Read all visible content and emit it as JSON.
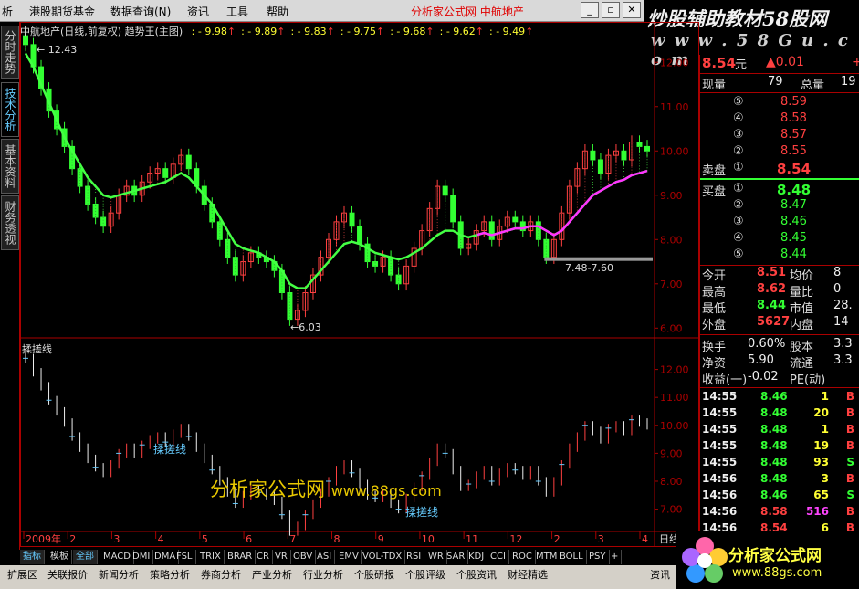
{
  "menu": {
    "items": [
      "析",
      "港股期货基金",
      "数据查询(N)",
      "资讯",
      "工具",
      "帮助"
    ],
    "title": "分析家公式网  中航地产"
  },
  "brand": {
    "title": "炒股辅助教材58股网",
    "url": "w w w . 5 8 G u . c o m"
  },
  "left_tabs": [
    "分时走势",
    "技术分析",
    "基本资料",
    "财务透视"
  ],
  "chart_title": "中航地产(日线,前复权) 趋势王(主图)",
  "ma_values": [
    "9.98",
    "9.89",
    "9.83",
    "9.75",
    "9.68",
    "9.62",
    "9.49"
  ],
  "ma_sep": ": - ",
  "annotations": {
    "high": "12.43",
    "low": "6.03",
    "range": "7.48-7.60",
    "sub_indicator": "揉搓线",
    "sub_label1": "揉搓线",
    "sub_label2": "揉搓线",
    "watermark1": "分析家公式网",
    "watermark2": "www.88gs.com"
  },
  "chart_data": {
    "type": "line",
    "main_ylim": [
      5.8,
      12.5
    ],
    "main_yticks": [
      "12.00",
      "11.00",
      "10.00",
      "9.00",
      "8.00",
      "7.00",
      "6.00"
    ],
    "sub_yticks": [
      "12.00",
      "11.00",
      "10.00",
      "9.00",
      "8.00",
      "7.00"
    ],
    "x_labels": [
      "2009年",
      "2",
      "3",
      "4",
      "5",
      "6",
      "7",
      "8",
      "9",
      "10",
      "11",
      "12",
      "2",
      "3",
      "4"
    ],
    "price": [
      12.4,
      11.9,
      11.4,
      10.9,
      10.5,
      10.1,
      9.6,
      9.2,
      8.8,
      8.5,
      8.3,
      8.6,
      9.0,
      9.2,
      9.0,
      9.3,
      9.5,
      9.6,
      9.4,
      9.7,
      9.9,
      9.6,
      9.2,
      8.8,
      8.4,
      8.0,
      7.6,
      7.2,
      7.5,
      7.7,
      7.6,
      7.5,
      7.3,
      6.8,
      6.2,
      6.4,
      6.8,
      7.2,
      7.6,
      8.0,
      8.4,
      8.6,
      8.3,
      7.9,
      7.5,
      7.4,
      7.6,
      7.2,
      7.0,
      7.4,
      7.8,
      8.2,
      8.7,
      9.2,
      9.0,
      8.4,
      7.8,
      7.9,
      8.2,
      8.4,
      8.0,
      8.3,
      8.5,
      8.4,
      8.2,
      8.4,
      8.0,
      7.6,
      8.0,
      8.6,
      9.2,
      9.6,
      10.0,
      9.8,
      9.5,
      9.9,
      10.0,
      9.8,
      10.2,
      10.1,
      10.0
    ],
    "avg_line": [
      12.2,
      11.9,
      11.5,
      11.1,
      10.7,
      10.3,
      10.0,
      9.7,
      9.4,
      9.2,
      9.0,
      8.95,
      9.0,
      9.05,
      9.1,
      9.15,
      9.2,
      9.25,
      9.3,
      9.4,
      9.5,
      9.4,
      9.2,
      9.0,
      8.8,
      8.5,
      8.2,
      7.9,
      7.8,
      7.75,
      7.7,
      7.6,
      7.5,
      7.3,
      7.0,
      6.9,
      6.9,
      7.1,
      7.3,
      7.5,
      7.7,
      7.9,
      7.95,
      7.9,
      7.8,
      7.7,
      7.65,
      7.6,
      7.55,
      7.6,
      7.7,
      7.8,
      7.95,
      8.1,
      8.2,
      8.2,
      8.1,
      8.05,
      8.1,
      8.15,
      8.1,
      8.15,
      8.2,
      8.25,
      8.25,
      8.3,
      8.3,
      8.2,
      8.1,
      8.2,
      8.4,
      8.6,
      8.8,
      9.0,
      9.1,
      9.2,
      9.3,
      9.35,
      9.45,
      9.5,
      9.55
    ]
  },
  "quote": {
    "price": "8.54",
    "unit": "元",
    "change": "▲0.01",
    "change2": "+",
    "now_vol_label": "现量",
    "now_vol": "79",
    "total_vol_label": "总量",
    "total_vol": "19",
    "asks": [
      {
        "lvl": "⑤",
        "p": "8.59"
      },
      {
        "lvl": "④",
        "p": "8.58"
      },
      {
        "lvl": "③",
        "p": "8.57"
      },
      {
        "lvl": "②",
        "p": "8.55"
      }
    ],
    "ask1_label": "卖盘",
    "ask1_lvl": "①",
    "ask1_p": "8.54",
    "bid1_label": "买盘",
    "bid1_lvl": "①",
    "bid1_p": "8.48",
    "bids": [
      {
        "lvl": "②",
        "p": "8.47"
      },
      {
        "lvl": "③",
        "p": "8.46"
      },
      {
        "lvl": "④",
        "p": "8.45"
      },
      {
        "lvl": "⑤",
        "p": "8.44"
      }
    ],
    "stats": [
      {
        "l1": "今开",
        "v1": "8.51",
        "c1": "red",
        "l2": "均价",
        "v2": "8"
      },
      {
        "l1": "最高",
        "v1": "8.62",
        "c1": "red",
        "l2": "量比",
        "v2": "0"
      },
      {
        "l1": "最低",
        "v1": "8.44",
        "c1": "grn",
        "l2": "市值",
        "v2": "28."
      },
      {
        "l1": "外盘",
        "v1": "5627",
        "c1": "red",
        "l2": "内盘",
        "v2": "14"
      }
    ],
    "fin": [
      {
        "l1": "换手",
        "v1": "0.60%",
        "l2": "股本",
        "v2": "3.3"
      },
      {
        "l1": "净资",
        "v1": "5.90",
        "l2": "流通",
        "v2": "3.3"
      },
      {
        "l1": "收益(一)",
        "v1": "-0.02",
        "l2": "PE(动)",
        "v2": ""
      }
    ],
    "ticks": [
      {
        "t": "14:55",
        "p": "8.46",
        "pc": "grn",
        "v": "1",
        "vc": "yel",
        "s": "B",
        "sc": "red"
      },
      {
        "t": "14:55",
        "p": "8.48",
        "pc": "grn",
        "v": "20",
        "vc": "yel",
        "s": "B",
        "sc": "red"
      },
      {
        "t": "14:55",
        "p": "8.48",
        "pc": "grn",
        "v": "1",
        "vc": "yel",
        "s": "B",
        "sc": "red"
      },
      {
        "t": "14:55",
        "p": "8.48",
        "pc": "grn",
        "v": "19",
        "vc": "yel",
        "s": "B",
        "sc": "red"
      },
      {
        "t": "14:55",
        "p": "8.48",
        "pc": "grn",
        "v": "93",
        "vc": "yel",
        "s": "S",
        "sc": "grn"
      },
      {
        "t": "14:56",
        "p": "8.48",
        "pc": "grn",
        "v": "3",
        "vc": "yel",
        "s": "B",
        "sc": "red"
      },
      {
        "t": "14:56",
        "p": "8.46",
        "pc": "grn",
        "v": "65",
        "vc": "yel",
        "s": "S",
        "sc": "grn"
      },
      {
        "t": "14:56",
        "p": "8.58",
        "pc": "red",
        "v": "516",
        "vc": "mag",
        "s": "B",
        "sc": "red"
      },
      {
        "t": "14:56",
        "p": "8.54",
        "pc": "red",
        "v": "6",
        "vc": "yel",
        "s": "B",
        "sc": "red"
      }
    ]
  },
  "indicator_tabs": [
    "指标",
    "模板",
    "全部",
    "MACD",
    "DMI",
    "DMA",
    "FSL",
    "TRIX",
    "BRAR",
    "CR",
    "VR",
    "OBV",
    "ASI",
    "EMV",
    "VOL-TDX",
    "RSI",
    "WR",
    "SAR",
    "KDJ",
    "CCI",
    "ROC",
    "MTM",
    "BOLL",
    "PSY",
    "+"
  ],
  "date_label": "日线",
  "bottom_items": [
    "扩展区",
    "关联报价",
    "新闻分析",
    "策略分析",
    "券商分析",
    "产业分析",
    "行业分析",
    "个股研报",
    "个股评级",
    "个股资讯",
    "财经精选",
    "资讯"
  ],
  "logo": {
    "title": "分析家公式网",
    "url": "www.88gs.com"
  }
}
